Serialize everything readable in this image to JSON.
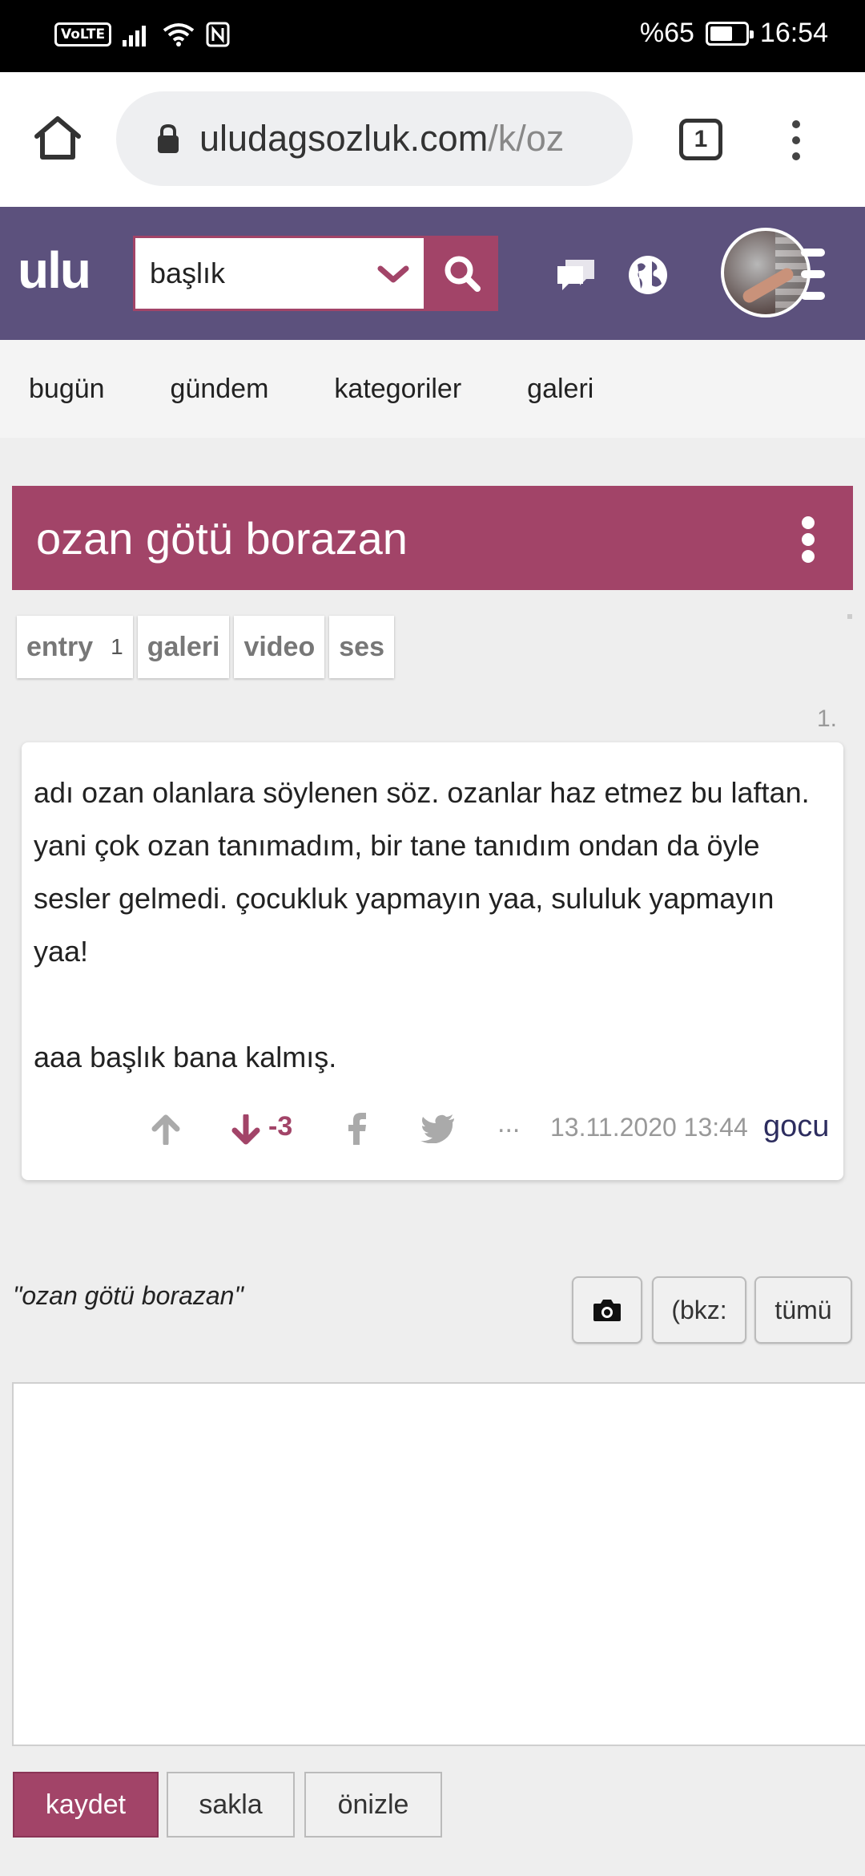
{
  "status_bar": {
    "volte": "VoLTE",
    "battery_percent": "%65",
    "battery_level": 0.65,
    "time": "16:54"
  },
  "browser": {
    "url_host": "uludagsozluk.com",
    "url_path": "/k/oz",
    "tab_count": "1"
  },
  "site": {
    "logo": "ulu",
    "search_value": "başlık",
    "accent": "#a24468",
    "header_bg": "#5c517d"
  },
  "nav": {
    "items": [
      "bugün",
      "gündem",
      "kategoriler",
      "galeri"
    ]
  },
  "topic": {
    "title": "ozan götü borazan"
  },
  "filters": {
    "entry_label": "entry",
    "entry_count": "1",
    "galeri": "galeri",
    "video": "video",
    "ses": "ses"
  },
  "entry": {
    "number": "1.",
    "text": "adı ozan olanlara söylenen söz. ozanlar haz etmez bu laftan. yani çok ozan tanımadım, bir tane tanıdım ondan da öyle sesler gelmedi. çocukluk yapmayın yaa, sululuk yapmayın yaa!\n\naaa başlık bana kalmış.",
    "score": "-3",
    "more": "...",
    "date": "13.11.2020 13:44",
    "author": "gocu"
  },
  "editor": {
    "topic_quote": "\"ozan götü borazan\"",
    "bkz_label": "(bkz:",
    "tumu_label": "tümü",
    "save_label": "kaydet",
    "hide_label": "sakla",
    "preview_label": "önizle"
  }
}
